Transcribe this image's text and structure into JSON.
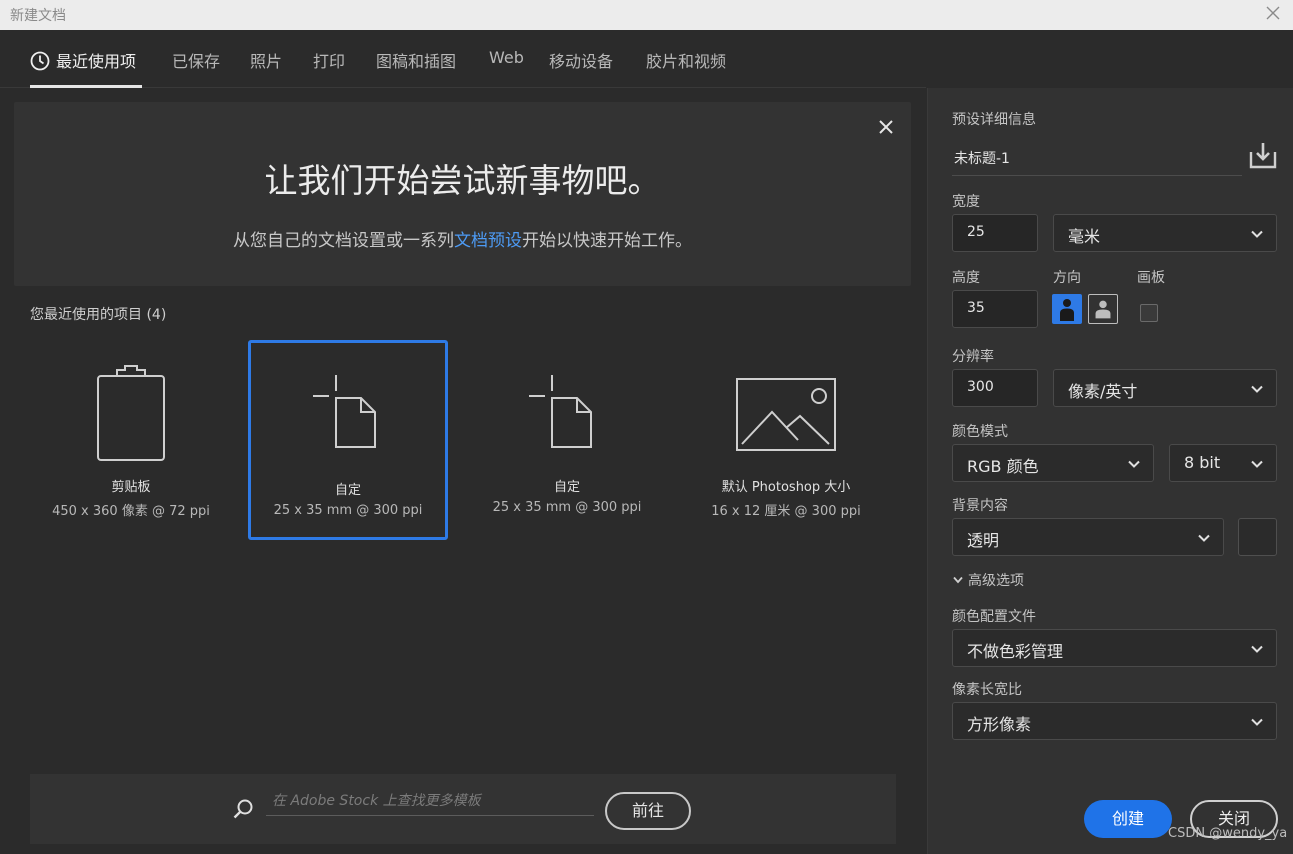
{
  "window": {
    "title": "新建文档"
  },
  "tabs": [
    {
      "label": "最近使用项"
    },
    {
      "label": "已保存"
    },
    {
      "label": "照片"
    },
    {
      "label": "打印"
    },
    {
      "label": "图稿和插图"
    },
    {
      "label": "Web"
    },
    {
      "label": "移动设备"
    },
    {
      "label": "胶片和视频"
    }
  ],
  "banner": {
    "headline": "让我们开始尝试新事物吧。",
    "sub_before": "从您自己的文档设置或一系列",
    "sub_link": "文档预设",
    "sub_after": "开始以快速开始工作。"
  },
  "recent": {
    "title": "您最近使用的项目 (4)",
    "items": [
      {
        "name": "剪贴板",
        "info": "450 x 360 像素 @ 72 ppi"
      },
      {
        "name": "自定",
        "info": "25 x 35 mm @ 300 ppi"
      },
      {
        "name": "自定",
        "info": "25 x 35 mm @ 300 ppi"
      },
      {
        "name": "默认 Photoshop 大小",
        "info": "16 x 12 厘米 @ 300 ppi"
      }
    ]
  },
  "stock": {
    "placeholder": "在 Adobe Stock 上查找更多模板",
    "go_label": "前往"
  },
  "preset": {
    "section_label": "预设详细信息",
    "name": "未标题-1",
    "width_label": "宽度",
    "width_value": "25",
    "width_unit": "毫米",
    "height_label": "高度",
    "height_value": "35",
    "orientation_label": "方向",
    "artboard_label": "画板",
    "resolution_label": "分辨率",
    "resolution_value": "300",
    "resolution_unit": "像素/英寸",
    "color_mode_label": "颜色模式",
    "color_mode": "RGB 颜色",
    "bit_depth": "8 bit",
    "background_label": "背景内容",
    "background": "透明",
    "advanced_label": "高级选项",
    "color_profile_label": "颜色配置文件",
    "color_profile": "不做色彩管理",
    "pixel_aspect_label": "像素长宽比",
    "pixel_aspect": "方形像素"
  },
  "actions": {
    "create_label": "创建",
    "close_label": "关闭"
  },
  "watermark": "CSDN @wendy_ya",
  "colors": {
    "accent": "#1f73e8",
    "selection": "#2e7ae6",
    "link": "#4d9bf5"
  }
}
